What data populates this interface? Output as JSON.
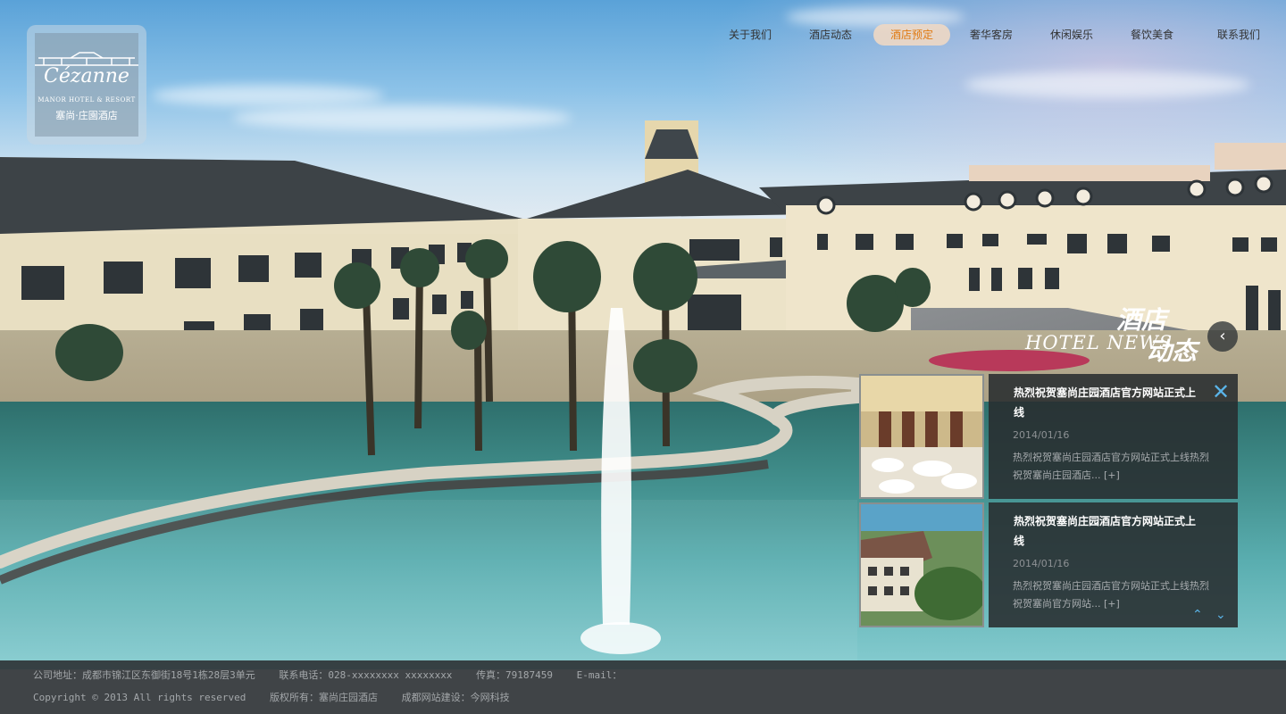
{
  "logo": {
    "script": "Cézanne",
    "subtitle": "MANOR HOTEL & RESORT",
    "chinese": "塞尚·庄園酒店"
  },
  "nav": {
    "items": [
      {
        "label": "关于我们"
      },
      {
        "label": "酒店动态"
      },
      {
        "label": "酒店预定",
        "active": true
      },
      {
        "label": "奢华客房"
      },
      {
        "label": "休闲娱乐"
      },
      {
        "label": "餐饮美食"
      },
      {
        "label": "联系我们"
      }
    ]
  },
  "news": {
    "title_cn_1": "酒店",
    "title_en": "HOTEL NEWS",
    "title_cn_2": "动态",
    "prev_icon": "chevron-left-icon",
    "cards": [
      {
        "title": "热烈祝贺塞尚庄园酒店官方网站正式上线",
        "date": "2014/01/16",
        "desc": "热烈祝贺塞尚庄园酒店官方网站正式上线热烈祝贺塞尚庄园酒店...",
        "more": "[+]"
      },
      {
        "title": "热烈祝贺塞尚庄园酒店官方网站正式上线",
        "date": "2014/01/16",
        "desc": "热烈祝贺塞尚庄园酒店官方网站正式上线热烈祝贺塞尚官方网站...",
        "more": "[+]"
      }
    ],
    "close_icon": "close-icon",
    "accent": "#5ab4e8"
  },
  "footer": {
    "address": "公司地址：成都市锦江区东御街18号1栋28层3单元",
    "phone": "联系电话：028-xxxxxxxx  xxxxxxxx",
    "fax": "传真：79187459",
    "email": "E-mail：",
    "copyright": "Copyright © 2013 All rights reserved",
    "owner": "版权所有：塞尚庄园酒店",
    "builder": "成都网站建设：今网科技"
  }
}
